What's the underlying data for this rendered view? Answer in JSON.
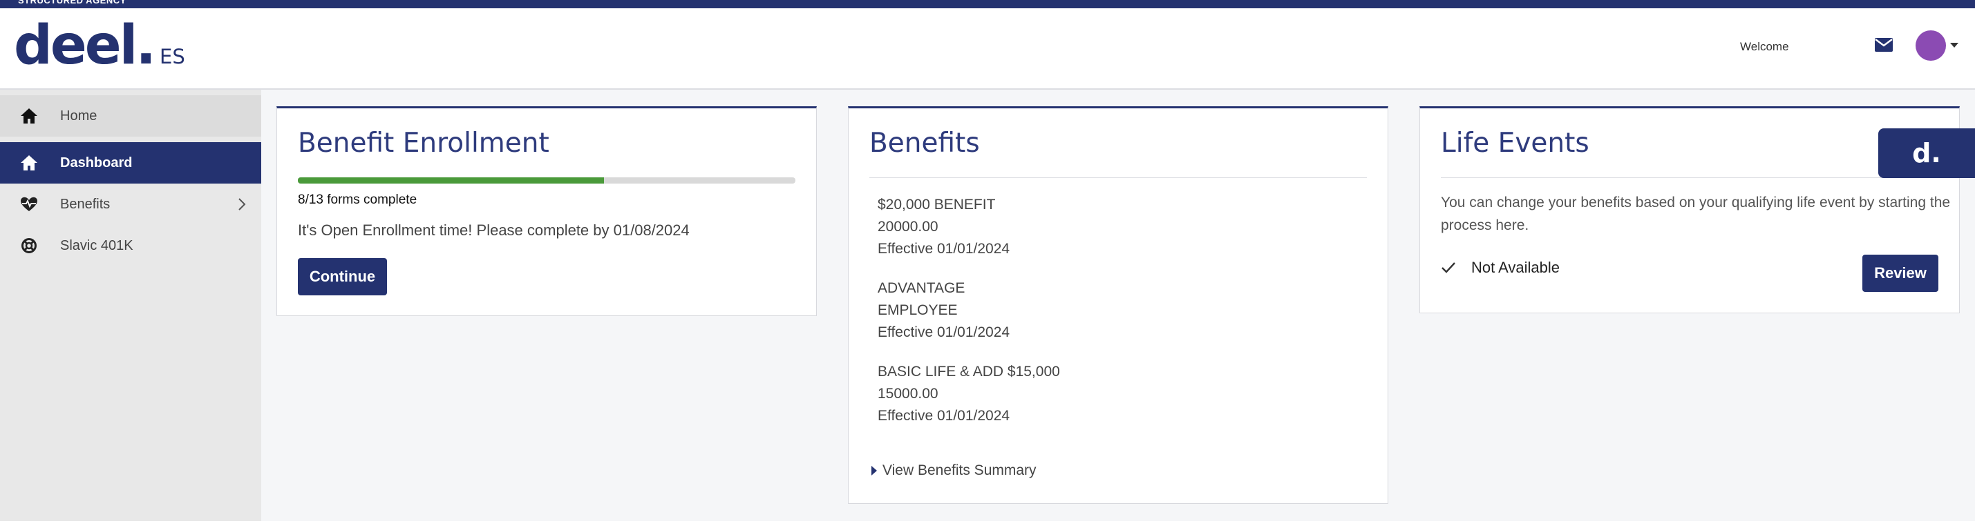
{
  "banner": {
    "text": "STRUCTURED AGENCY"
  },
  "header": {
    "logo_main": "deel.",
    "logo_sub": "ES",
    "welcome": "Welcome",
    "icons": {
      "mail": "mail-icon",
      "avatar_color": "#8b4bb3"
    }
  },
  "sidebar": {
    "items": [
      {
        "label": "Home",
        "icon": "home-icon"
      },
      {
        "label": "Dashboard",
        "icon": "home-icon",
        "active": true
      },
      {
        "label": "Benefits",
        "icon": "heartbeat-icon",
        "has_submenu": true
      },
      {
        "label": "Slavic 401K",
        "icon": "lifebuoy-icon"
      }
    ]
  },
  "enrollment": {
    "title": "Benefit Enrollment",
    "progress_fraction": 0.615,
    "forms_complete": "8/13 forms complete",
    "message": "It's Open Enrollment time! Please complete by 01/08/2024",
    "continue_label": "Continue"
  },
  "benefits": {
    "title": "Benefits",
    "items": [
      {
        "name": "$20,000 BENEFIT",
        "value": "20000.00",
        "effective": "Effective 01/01/2024"
      },
      {
        "name": "ADVANTAGE",
        "value": "EMPLOYEE",
        "effective": "Effective 01/01/2024"
      },
      {
        "name": "BASIC LIFE & ADD $15,000",
        "value": "15000.00",
        "effective": "Effective 01/01/2024"
      }
    ],
    "view_summary": "View Benefits Summary"
  },
  "life_events": {
    "title": "Life Events",
    "description": "You can change your benefits based on your qualifying life event by starting the process here.",
    "status": "Not Available",
    "review_label": "Review"
  },
  "badge": {
    "text": "d."
  },
  "colors": {
    "brand": "#243270",
    "progress": "#4a9a3a",
    "sidebar_bg": "#e8e8e8",
    "main_bg": "#f5f6f8"
  }
}
